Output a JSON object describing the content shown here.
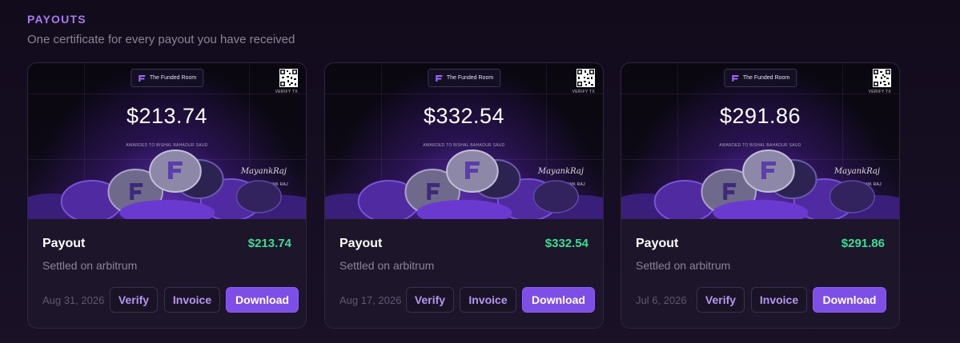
{
  "section": {
    "title": "PAYOUTS",
    "subtitle": "One certificate for every payout you have received"
  },
  "certificate": {
    "brand": "The Funded Room",
    "verify_label": "VERIFY TX",
    "awarded_to": "AWARDED TO BISHAL BAHADUR SAUD",
    "signature": "MayankRaj",
    "signed_by": "SIGNED BY MAYANK RAJ"
  },
  "buttons": {
    "verify": "Verify",
    "invoice": "Invoice",
    "download": "Download"
  },
  "colors": {
    "accent": "#7e4fe6",
    "positive": "#3ddc97",
    "muted": "#8b8497"
  },
  "payouts": [
    {
      "label": "Payout",
      "amount": "$213.74",
      "settled": "Settled on arbitrum",
      "date": "Aug 31, 2026"
    },
    {
      "label": "Payout",
      "amount": "$332.54",
      "settled": "Settled on arbitrum",
      "date": "Aug 17, 2026"
    },
    {
      "label": "Payout",
      "amount": "$291.86",
      "settled": "Settled on arbitrum",
      "date": "Jul 6, 2026"
    }
  ]
}
